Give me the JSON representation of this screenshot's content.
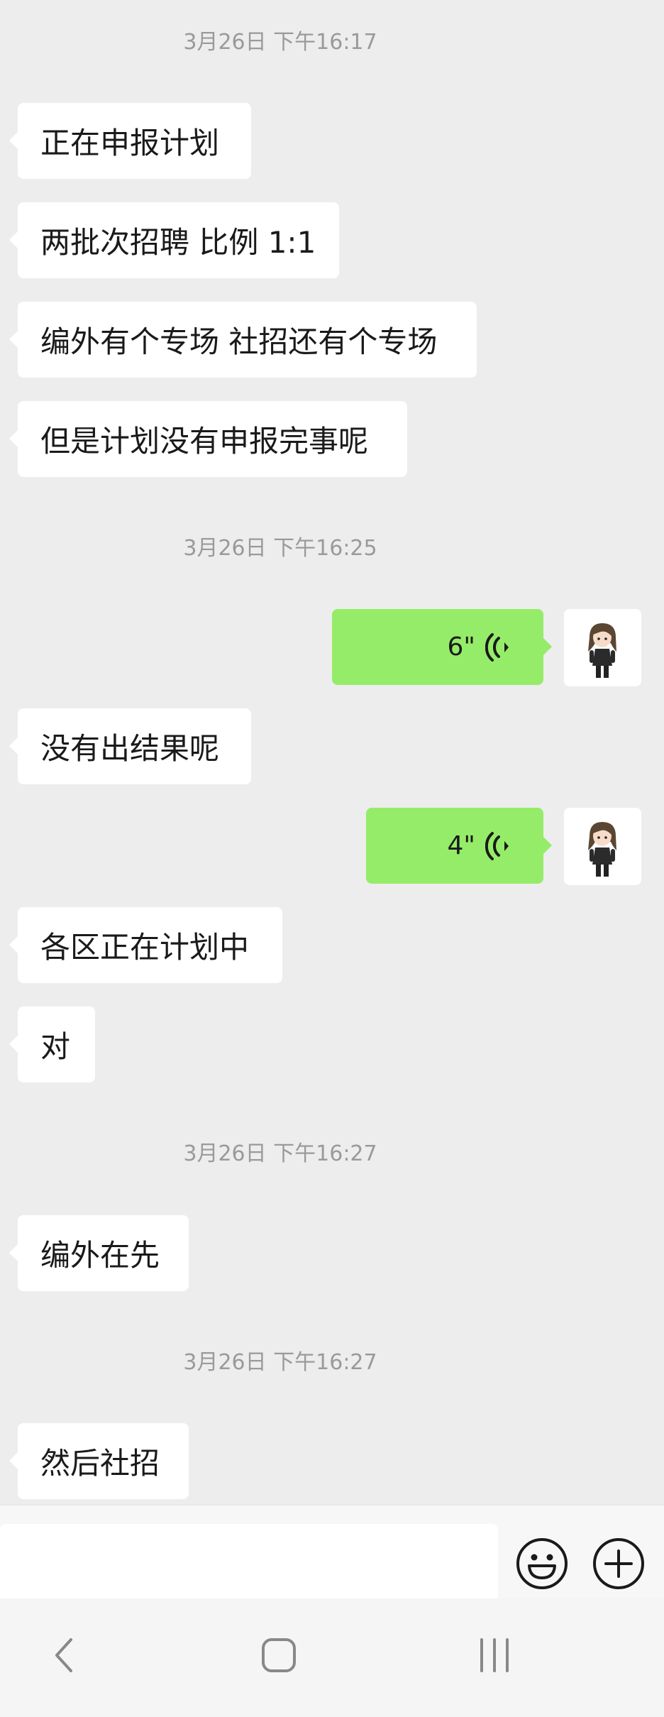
{
  "chat": {
    "timestamps": [
      "3月26日 下午16:17",
      "3月26日 下午16:25",
      "3月26日 下午16:27",
      "3月26日 下午16:27"
    ],
    "messages": {
      "m1": "正在申报计划",
      "m2": "两批次招聘 比例 1:1",
      "m3": "编外有个专场 社招还有个专场",
      "m4": "但是计划没有申报完事呢",
      "m5": "没有出结果呢",
      "m6": "各区正在计划中",
      "m7": "对",
      "m8": "编外在先",
      "m9": "然后社招"
    },
    "voice": [
      {
        "duration": "6\""
      },
      {
        "duration": "4\""
      }
    ]
  },
  "input": {
    "value": ""
  },
  "icons": {
    "emoji": "emoji-icon",
    "add": "plus-circle-icon",
    "back": "back-icon",
    "home": "home-icon",
    "recents": "recents-icon"
  },
  "colors": {
    "background": "#ededed",
    "incoming_bubble": "#ffffff",
    "outgoing_bubble": "#95ec69",
    "timestamp": "#9a9a9a"
  }
}
